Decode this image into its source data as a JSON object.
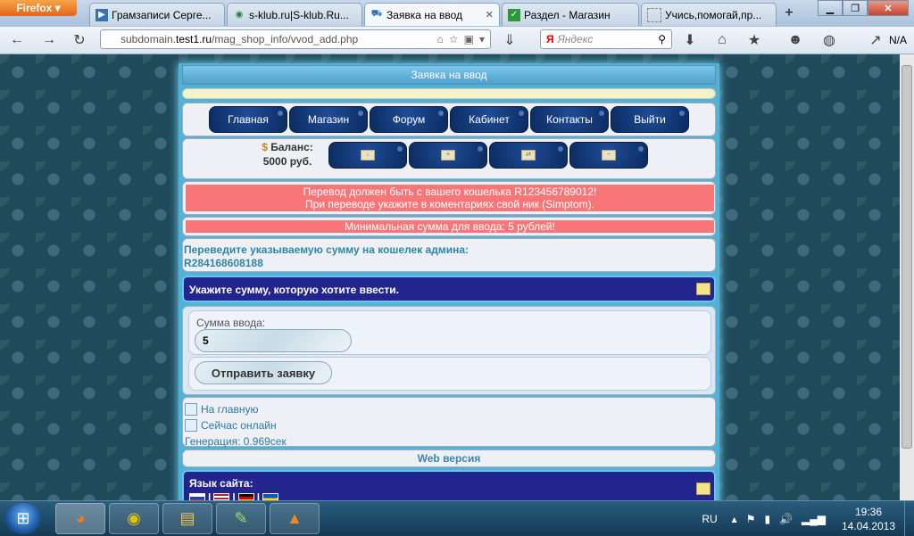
{
  "browser": {
    "menu_button": "Firefox",
    "tabs": [
      {
        "label": "Грамзаписи Серге...",
        "icon": "play-icon"
      },
      {
        "label": "s-klub.ru|S-klub.Ru...",
        "icon": "globe-icon"
      },
      {
        "label": "Заявка на ввод",
        "icon": "cart-icon"
      },
      {
        "label": "Раздел - Магазин",
        "icon": "checkbox-icon"
      },
      {
        "label": "Учись,помогай,пр...",
        "icon": "page-icon"
      }
    ],
    "url_host_prefix": "subdomain.",
    "url_host": "test1.ru",
    "url_path": "/mag_shop_info/vvod_add.php",
    "search_logo": "Я",
    "search_placeholder": "Яндекс",
    "extra": "N/A"
  },
  "site": {
    "header_title": "Заявка на ввод",
    "menu": [
      "Главная",
      "Магазин",
      "Форум",
      "Кабинет",
      "Контакты",
      "Выйти"
    ],
    "balance_label": "Баланс:",
    "balance_value": "5000 руб.",
    "notice_line1": "Перевод должен быть с вашего кошелька R123456789012!",
    "notice_line2": "При переводе укажите в коментариях свой ник (Simptom).",
    "min_amount": "Минимальная сумма для ввода: 5 рублей!",
    "transfer_line1": "Переведите указываемую сумму на кошелек админа:",
    "transfer_line2": "R284168608188",
    "amount_heading": "Укажите сумму, которую хотите ввести.",
    "amount_label": "Сумма ввода:",
    "amount_value": "5",
    "submit_label": "Отправить заявку",
    "link_home": "На главную",
    "link_online": "Сейчас онлайн",
    "generation": "Генерация: 0.969сек",
    "web_version": "Web версия",
    "language_label": "Язык сайта:"
  },
  "taskbar": {
    "lang": "RU",
    "time": "19:36",
    "date": "14.04.2013"
  }
}
